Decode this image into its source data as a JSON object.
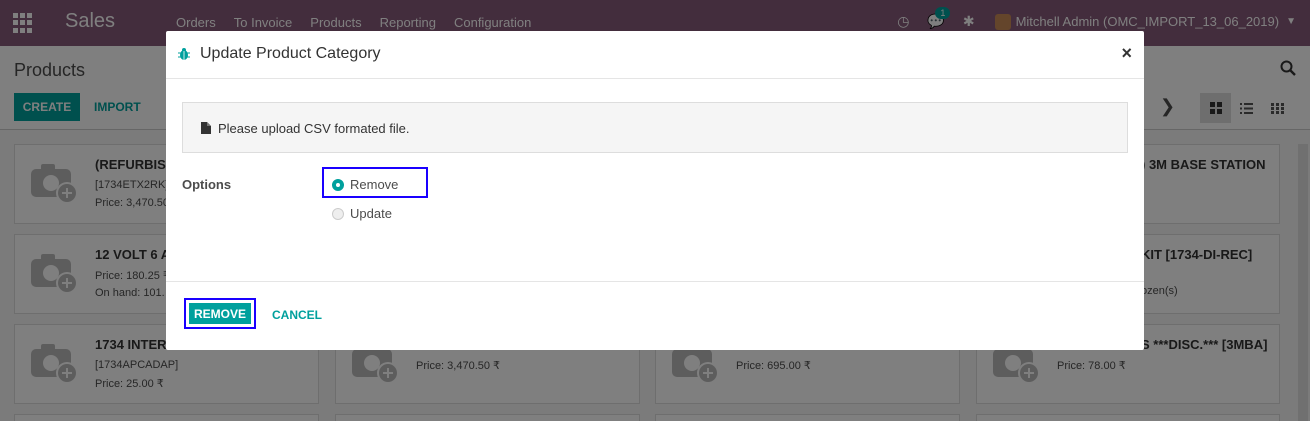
{
  "navbar": {
    "brand": "Sales",
    "menu": [
      "Orders",
      "To Invoice",
      "Products",
      "Reporting",
      "Configuration"
    ],
    "messages_count": "1",
    "user_label": "Mitchell Admin (OMC_IMPORT_13_06_2019)"
  },
  "control_panel": {
    "breadcrumb": "Products",
    "create_label": "CREATE",
    "import_label": "IMPORT"
  },
  "kanban": {
    "cards": [
      {
        "title": "(REFURBISH",
        "line2": "[1734ETX2RK]",
        "line3": "Price: 3,470.50"
      },
      {
        "title": "12 VOLT 6 A",
        "line2": "Price: 180.25 ₹",
        "line3": "On hand: 101."
      },
      {
        "title": "1734 INTERC",
        "line2": "[1734APCADAP]",
        "line3": "Price: 25.00 ₹"
      },
      {
        "title": ") 3M BASE STATION",
        "line2": "",
        "line3": ""
      },
      {
        "title": "KIT [1734-DI-REC]",
        "line2": "",
        "line3": "ozen(s)"
      },
      {
        "title": "S ***DISC.*** [3MBA]",
        "line2": "Price: 78.00 ₹",
        "line3": ""
      },
      {
        "title": "",
        "line2": "Price: 3,470.50 ₹",
        "line3": ""
      },
      {
        "title": "",
        "line2": "Price: 695.00 ₹",
        "line3": ""
      }
    ]
  },
  "modal": {
    "title": "Update Product Category",
    "info": "Please upload CSV formated file.",
    "options_label": "Options",
    "option_remove": "Remove",
    "option_update": "Update",
    "remove_button": "REMOVE",
    "cancel_button": "CANCEL"
  }
}
